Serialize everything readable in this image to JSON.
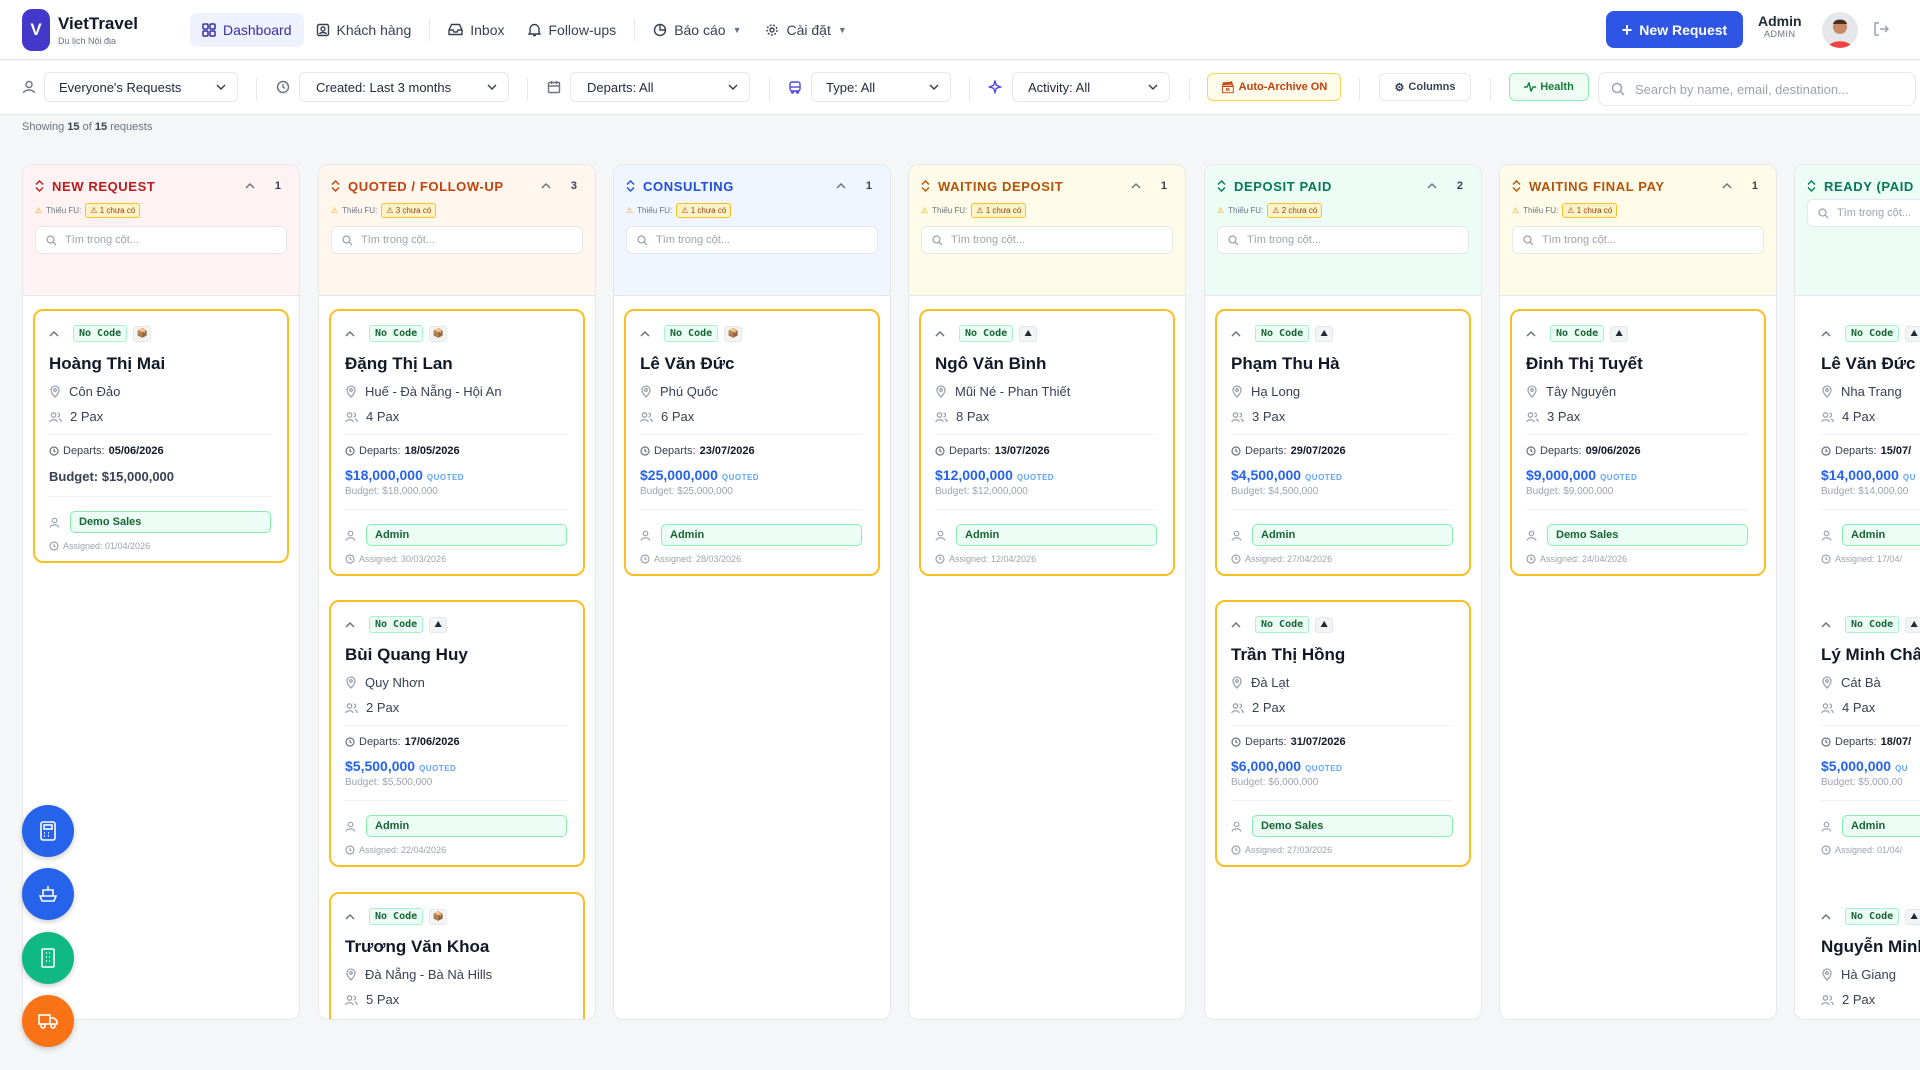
{
  "app": {
    "name": "VietTravel",
    "subtitle": "Du lịch Nội địa"
  },
  "nav": [
    {
      "label": "Dashboard",
      "icon": "grid-icon",
      "active": true
    },
    {
      "label": "Khách hàng",
      "icon": "contacts-icon"
    },
    {
      "label": "Inbox",
      "icon": "inbox-icon"
    },
    {
      "label": "Follow-ups",
      "icon": "bell-icon"
    },
    {
      "label": "Báo cáo",
      "icon": "pie-chart-icon"
    },
    {
      "label": "Cài đặt",
      "icon": "gear-icon"
    }
  ],
  "actions": {
    "new_request": "New Request"
  },
  "user": {
    "name": "Admin",
    "role": "ADMIN"
  },
  "filters": {
    "owner": "Everyone's Requests",
    "created": "Created: Last 3 months",
    "departs": "Departs: All",
    "type": "Type: All",
    "activity": "Activity: All",
    "auto_archive": "Auto-Archive ON",
    "columns": "Columns",
    "health": "Health",
    "search_placeholder": "Search by name, email, destination..."
  },
  "summary": {
    "prefix": "Showing",
    "shown": "15",
    "of": "of",
    "total": "15",
    "suffix": "requests"
  },
  "column_search_placeholder": "Tìm trong cột...",
  "fu_label": "Thiếu FU:",
  "columns": [
    {
      "title": "NEW REQUEST",
      "count": "1",
      "fu": "1 chưa có",
      "color": "#b91c1c",
      "bg": "#fef2f2",
      "cards": [
        {
          "code": "No Code",
          "tag": "📦",
          "name": "Hoàng Thị Mai",
          "destination": "Côn Đảo",
          "pax": "2 Pax",
          "departs_label": "Departs:",
          "departs": "05/06/2026",
          "budget_main": "Budget: $15,000,000",
          "assignee": "Demo Sales",
          "assigned": "Assigned: 01/04/2026"
        }
      ]
    },
    {
      "title": "QUOTED / FOLLOW-UP",
      "count": "3",
      "fu": "3 chưa có",
      "color": "#c2410c",
      "bg": "#fff7ed",
      "cards": [
        {
          "code": "No Code",
          "tag": "📦",
          "name": "Đặng Thị Lan",
          "destination": "Huế - Đà Nẵng - Hội An",
          "pax": "4 Pax",
          "departs_label": "Departs:",
          "departs": "18/05/2026",
          "quoted": "$18,000,000",
          "quoted_label": "QUOTED",
          "budget": "Budget: $18,000,000",
          "assignee": "Admin",
          "assigned": "Assigned: 30/03/2026"
        },
        {
          "code": "No Code",
          "tag": "⛰",
          "name": "Bùi Quang Huy",
          "destination": "Quy Nhơn",
          "pax": "2 Pax",
          "departs_label": "Departs:",
          "departs": "17/06/2026",
          "quoted": "$5,500,000",
          "quoted_label": "QUOTED",
          "budget": "Budget: $5,500,000",
          "assignee": "Admin",
          "assigned": "Assigned: 22/04/2026"
        },
        {
          "code": "No Code",
          "tag": "📦",
          "name": "Trương Văn Khoa",
          "destination": "Đà Nẵng - Bà Nà Hills",
          "pax": "5 Pax"
        }
      ]
    },
    {
      "title": "CONSULTING",
      "count": "1",
      "fu": "1 chưa có",
      "color": "#1d4ed8",
      "bg": "#eff6ff",
      "cards": [
        {
          "code": "No Code",
          "tag": "📦",
          "name": "Lê Văn Đức",
          "destination": "Phú Quốc",
          "pax": "6 Pax",
          "departs_label": "Departs:",
          "departs": "23/07/2026",
          "quoted": "$25,000,000",
          "quoted_label": "QUOTED",
          "budget": "Budget: $25,000,000",
          "assignee": "Admin",
          "assigned": "Assigned: 28/03/2026"
        }
      ]
    },
    {
      "title": "WAITING DEPOSIT",
      "count": "1",
      "fu": "1 chưa có",
      "color": "#b45309",
      "bg": "#fefce8",
      "cards": [
        {
          "code": "No Code",
          "tag": "⛰",
          "name": "Ngô Văn Bình",
          "destination": "Mũi Né - Phan Thiết",
          "pax": "8 Pax",
          "departs_label": "Departs:",
          "departs": "13/07/2026",
          "quoted": "$12,000,000",
          "quoted_label": "QUOTED",
          "budget": "Budget: $12,000,000",
          "assignee": "Admin",
          "assigned": "Assigned: 12/04/2026"
        }
      ]
    },
    {
      "title": "DEPOSIT PAID",
      "count": "2",
      "fu": "2 chưa có",
      "color": "#047857",
      "bg": "#ecfdf5",
      "cards": [
        {
          "code": "No Code",
          "tag": "⛰",
          "name": "Phạm Thu Hà",
          "destination": "Hạ Long",
          "pax": "3 Pax",
          "departs_label": "Departs:",
          "departs": "29/07/2026",
          "quoted": "$4,500,000",
          "quoted_label": "QUOTED",
          "budget": "Budget: $4,500,000",
          "assignee": "Admin",
          "assigned": "Assigned: 27/04/2026"
        },
        {
          "code": "No Code",
          "tag": "⛰",
          "name": "Trần Thị Hồng",
          "destination": "Đà Lạt",
          "pax": "2 Pax",
          "departs_label": "Departs:",
          "departs": "31/07/2026",
          "quoted": "$6,000,000",
          "quoted_label": "QUOTED",
          "budget": "Budget: $6,000,000",
          "assignee": "Demo Sales",
          "assigned": "Assigned: 27/03/2026"
        }
      ]
    },
    {
      "title": "WAITING FINAL PAY",
      "count": "1",
      "fu": "1 chưa có",
      "color": "#b45309",
      "bg": "#fefce8",
      "cards": [
        {
          "code": "No Code",
          "tag": "⛰",
          "name": "Đinh Thị Tuyết",
          "destination": "Tây Nguyên",
          "pax": "3 Pax",
          "departs_label": "Departs:",
          "departs": "09/06/2026",
          "quoted": "$9,000,000",
          "quoted_label": "QUOTED",
          "budget": "Budget: $9,000,000",
          "assignee": "Demo Sales",
          "assigned": "Assigned: 24/04/2026"
        }
      ]
    },
    {
      "title": "READY (PAID",
      "count": "",
      "fu": "",
      "color": "#047857",
      "bg": "#ecfdf5",
      "cards": [
        {
          "code": "No Code",
          "tag": "⛰",
          "name": "Lê Văn Đức",
          "destination": "Nha Trang",
          "pax": "4 Pax",
          "departs_label": "Departs:",
          "departs": "15/07/",
          "quoted": "$14,000,000",
          "quoted_label": "QU",
          "budget": "Budget: $14,000,00",
          "assignee": "Admin",
          "assigned": "Assigned: 17/04/"
        },
        {
          "code": "No Code",
          "tag": "⛰",
          "name": "Lý Minh Châ",
          "destination": "Cát Bà",
          "pax": "4 Pax",
          "departs_label": "Departs:",
          "departs": "18/07/",
          "quoted": "$5,000,000",
          "quoted_label": "QU",
          "budget": "Budget: $5,000,00",
          "assignee": "Admin",
          "assigned": "Assigned: 01/04/"
        },
        {
          "code": "No Code",
          "tag": "⛰",
          "name": "Nguyễn Minh",
          "destination": "Hà Giang",
          "pax": "2 Pax"
        }
      ]
    }
  ],
  "fabs": [
    {
      "icon": "calculator-icon",
      "color": "#2563eb"
    },
    {
      "icon": "ferry-icon",
      "color": "#2563eb"
    },
    {
      "icon": "building-icon",
      "color": "#10b981"
    },
    {
      "icon": "truck-icon",
      "color": "#f97316"
    }
  ]
}
